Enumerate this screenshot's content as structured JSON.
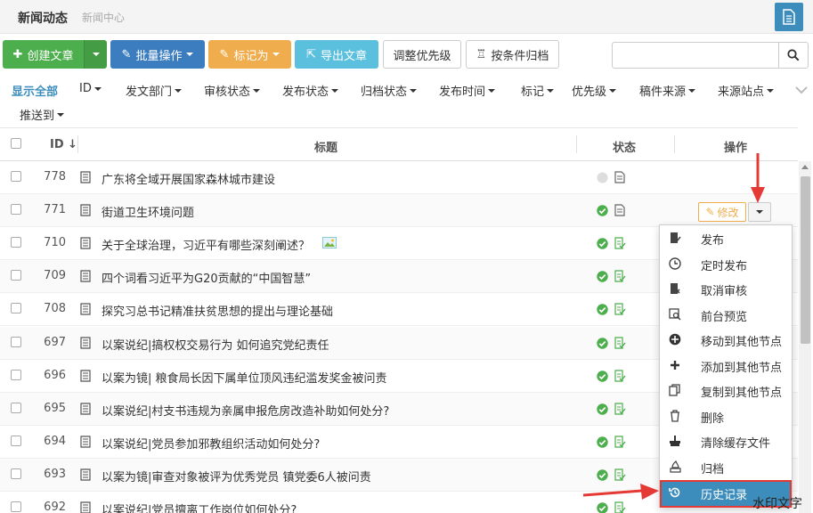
{
  "header": {
    "title": "新闻动态",
    "subtitle": "新闻中心"
  },
  "toolbar": {
    "create_label": "创建文章",
    "batch_label": "批量操作",
    "mark_label": "标记为",
    "export_label": "导出文章",
    "priority_label": "调整优先级",
    "archive_label": "按条件归档"
  },
  "search": {
    "value": "",
    "placeholder": ""
  },
  "filters": {
    "show_all": "显示全部",
    "items": [
      "ID",
      "发文部门",
      "审核状态",
      "发布状态",
      "归档状态",
      "发布时间",
      "标记",
      "优先级",
      "稿件来源",
      "来源站点",
      "推送到"
    ]
  },
  "table": {
    "headers": {
      "id": "ID",
      "title": "标题",
      "status": "状态",
      "actions": "操作"
    },
    "rows": [
      {
        "id": "778",
        "title": "广东将全域开展国家森林城市建设",
        "status": "draft"
      },
      {
        "id": "771",
        "title": "街道卫生环境问题",
        "status": "approved"
      },
      {
        "id": "710",
        "title": "关于全球治理，习近平有哪些深刻阐述？",
        "status": "published",
        "has_image": true
      },
      {
        "id": "709",
        "title": "四个词看习近平为G20贡献的“中国智慧”",
        "status": "published"
      },
      {
        "id": "708",
        "title": "探究习总书记精准扶贫思想的提出与理论基础",
        "status": "published"
      },
      {
        "id": "697",
        "title": "以案说纪|搞权权交易行为 如何追究党纪责任",
        "status": "published"
      },
      {
        "id": "696",
        "title": "以案为镜| 粮食局长因下属单位顶风违纪滥发奖金被问责",
        "status": "published"
      },
      {
        "id": "695",
        "title": "以案说纪|村支书违规为亲属申报危房改造补助如何处分?",
        "status": "published"
      },
      {
        "id": "694",
        "title": "以案说纪|党员参加邪教组织活动如何处分?",
        "status": "published"
      },
      {
        "id": "693",
        "title": "以案为镜|审查对象被评为优秀党员 镇党委6人被问责",
        "status": "published"
      },
      {
        "id": "692",
        "title": "以案说纪|党员擅离工作岗位如何处分?",
        "status": "published"
      }
    ]
  },
  "row_actions": {
    "edit_label": "修改"
  },
  "menu": {
    "items": [
      {
        "label": "发布",
        "icon": "publish-icon"
      },
      {
        "label": "定时发布",
        "icon": "clock-icon"
      },
      {
        "label": "取消审核",
        "icon": "unapprove-icon"
      },
      {
        "label": "前台预览",
        "icon": "preview-icon"
      },
      {
        "label": "移动到其他节点",
        "icon": "move-icon"
      },
      {
        "label": "添加到其他节点",
        "icon": "plus-icon"
      },
      {
        "label": "复制到其他节点",
        "icon": "copy-icon"
      },
      {
        "label": "删除",
        "icon": "trash-icon"
      },
      {
        "label": "清除缓存文件",
        "icon": "clear-cache-icon"
      },
      {
        "label": "归档",
        "icon": "archive-icon"
      },
      {
        "label": "历史记录",
        "icon": "history-icon"
      }
    ]
  },
  "watermark": "水印文字",
  "colors": {
    "primary": "#3c8dbc",
    "green": "#4cae4c",
    "orange": "#f0ad4e",
    "cyan": "#5bc0de",
    "red_annotation": "#e53935"
  }
}
